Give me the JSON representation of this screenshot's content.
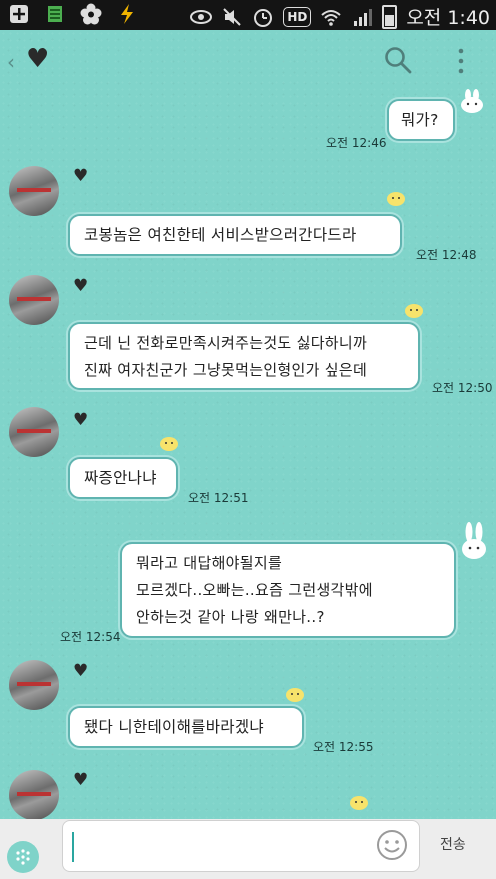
{
  "status_bar": {
    "icons": [
      "plus-icon",
      "notes-icon",
      "flower-icon",
      "flash-icon",
      "eye-icon",
      "mute-icon",
      "alarm-icon",
      "hd-icon",
      "wifi-icon",
      "signal-icon",
      "battery-icon"
    ],
    "hd_label": "HD",
    "time": "오전 1:40"
  },
  "header": {
    "back": "‹",
    "favorite": "♥"
  },
  "messages": [
    {
      "side": "right",
      "text": "뭐가?",
      "time": "오전 12:46"
    },
    {
      "side": "left",
      "text": "코봉놈은 여친한테 서비스받으러간다드라",
      "time": "오전 12:48"
    },
    {
      "side": "left",
      "text": "근데 닌 전화로만족시켜주는것도 싫다하니까\n진짜 여자친군가 그냥못먹는인형인가 싶은데",
      "time": "오전 12:50"
    },
    {
      "side": "left",
      "text": "짜증안나냐",
      "time": "오전 12:51"
    },
    {
      "side": "right",
      "text": "뭐라고 대답해야될지를\n모르겠다..오빠는..요즘 그런생각밖에\n안하는것 같아  나랑 왜만나..?",
      "time": "오전 12:54"
    },
    {
      "side": "left",
      "text": "됐다 니한테이해를바라겠냐",
      "time": "오전 12:55"
    }
  ],
  "sender_name_icon": "♥",
  "input": {
    "placeholder": "",
    "value": "",
    "send_label": "전송"
  },
  "colors": {
    "chat_background": "#80d4ca",
    "bubble_border": "#5fb4b0",
    "status_bar": "#141414"
  }
}
